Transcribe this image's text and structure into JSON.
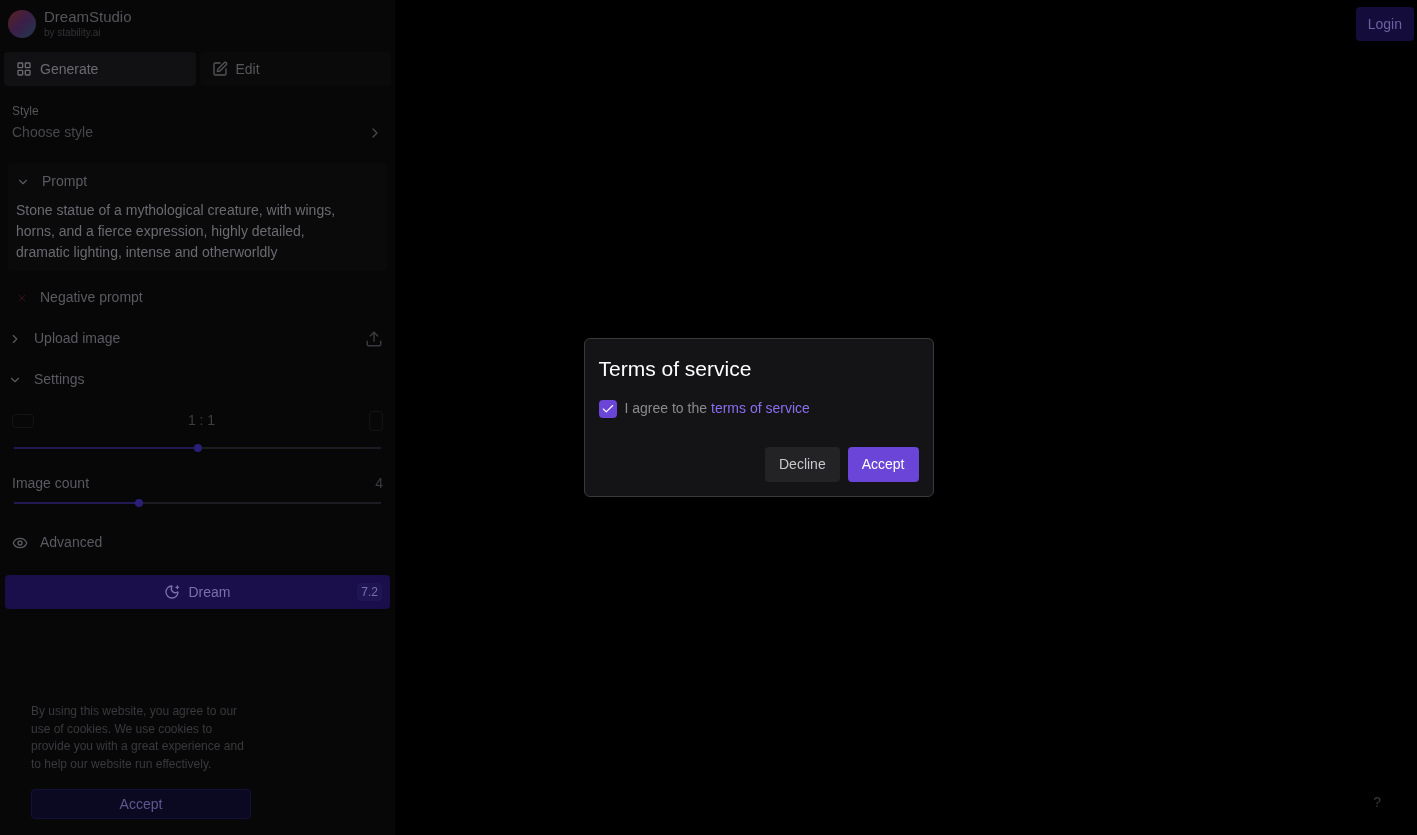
{
  "app": {
    "name": "DreamStudio",
    "byline": "by stability.ai"
  },
  "login": "Login",
  "tabs": [
    {
      "label": "Generate",
      "selected": true
    },
    {
      "label": "Edit",
      "selected": false
    }
  ],
  "style": {
    "label": "Style",
    "value": "Choose style"
  },
  "prompt": {
    "label": "Prompt",
    "expanded": true,
    "text": "Stone statue of a mythological creature, with wings, horns, and a fierce expression, highly detailed, dramatic lighting, intense and otherworldly"
  },
  "negative_prompt": {
    "label": "Negative prompt"
  },
  "sections": [
    {
      "label": "Upload image",
      "expanded": false
    },
    {
      "label": "Settings",
      "expanded": true
    }
  ],
  "aspect": {
    "reading": "1 : 1",
    "level": 0.5
  },
  "image_count": {
    "label": "Image count",
    "reading": "4",
    "level": 0.34
  },
  "advanced": "Advanced",
  "dream": {
    "label": "Dream",
    "cost": "7.2"
  },
  "cookie": {
    "text": "By using this website, you agree to our use of cookies. We use cookies to provide you with a great experience and to help our website run effectively.",
    "button": "Accept"
  },
  "help": "?",
  "dialog": {
    "title": "Terms of service",
    "checked": true,
    "agree": "I agree to the",
    "link": "terms of service",
    "buttons": [
      {
        "label": "Decline",
        "kind": "secondary"
      },
      {
        "label": "Accept",
        "kind": "primary"
      }
    ]
  }
}
